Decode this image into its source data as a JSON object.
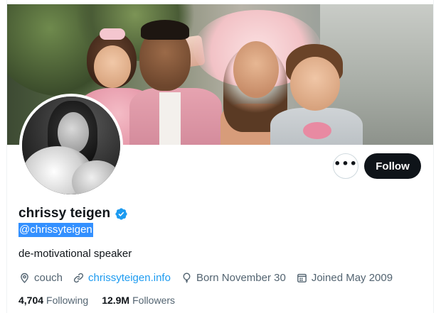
{
  "colors": {
    "text_primary": "#0f1419",
    "text_secondary": "#536471",
    "link": "#1d9bf0",
    "verified": "#1d9bf0",
    "follow_button_bg": "#0f1419",
    "selection_highlight": "#3390ff"
  },
  "profile": {
    "display_name": "chrissy teigen",
    "handle": "@chrissyteigen",
    "verified": true,
    "bio": "de-motivational speaker",
    "banner": "family photo banner",
    "avatar": "black and white portrait avatar"
  },
  "actions": {
    "more_icon": "more-options-icon",
    "more_label": "•••",
    "follow_label": "Follow"
  },
  "meta": {
    "location": {
      "icon": "location-pin-icon",
      "text": "couch"
    },
    "website": {
      "icon": "link-icon",
      "text": "chrissyteigen.info"
    },
    "birthday": {
      "icon": "balloon-icon",
      "text": "Born November 30"
    },
    "joined": {
      "icon": "calendar-icon",
      "text": "Joined May 2009"
    }
  },
  "stats": {
    "following": {
      "count": "4,704",
      "label": "Following"
    },
    "followers": {
      "count": "12.9M",
      "label": "Followers"
    }
  }
}
